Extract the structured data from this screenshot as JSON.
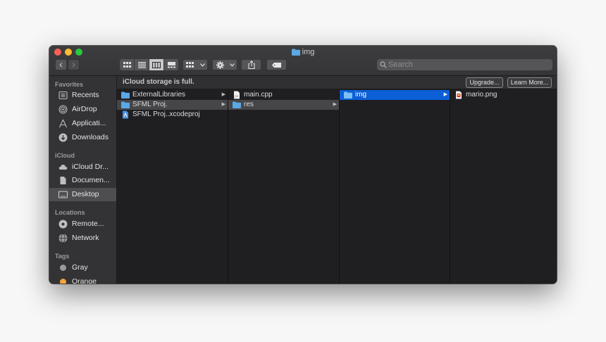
{
  "window": {
    "title": "img"
  },
  "toolbar": {
    "back_label": "‹",
    "forward_label": "›",
    "search_placeholder": "Search"
  },
  "sidebar": {
    "favorites_heading": "Favorites",
    "favorites": [
      {
        "label": "Recents",
        "icon": "clock-icon"
      },
      {
        "label": "AirDrop",
        "icon": "airdrop-icon"
      },
      {
        "label": "Applicati...",
        "icon": "applications-icon"
      },
      {
        "label": "Downloads",
        "icon": "download-icon"
      }
    ],
    "icloud_heading": "iCloud",
    "icloud": [
      {
        "label": "iCloud Dr...",
        "icon": "cloud-icon"
      },
      {
        "label": "Documen...",
        "icon": "document-icon"
      },
      {
        "label": "Desktop",
        "icon": "desktop-icon",
        "selected": true
      }
    ],
    "locations_heading": "Locations",
    "locations": [
      {
        "label": "Remote...",
        "icon": "disc-icon"
      },
      {
        "label": "Network",
        "icon": "network-icon"
      }
    ],
    "tags_heading": "Tags",
    "tags": [
      {
        "label": "Gray",
        "color": "#9a9a9c"
      },
      {
        "label": "Orange",
        "color": "#f5a43a"
      }
    ]
  },
  "banner": {
    "message": "iCloud storage is full.",
    "upgrade_label": "Upgrade...",
    "learn_more_label": "Learn More..."
  },
  "columns": [
    [
      {
        "label": "ExternalLibraries",
        "type": "folder",
        "has_children": true
      },
      {
        "label": "SFML Proj.",
        "type": "folder",
        "has_children": true,
        "state": "highlight"
      },
      {
        "label": "SFML Proj..xcodeproj",
        "type": "xcodeproj",
        "has_children": false
      }
    ],
    [
      {
        "label": "main.cpp",
        "type": "cpp-file",
        "has_children": false
      },
      {
        "label": "res",
        "type": "folder",
        "has_children": true,
        "state": "highlight"
      }
    ],
    [
      {
        "label": "img",
        "type": "folder",
        "has_children": true,
        "state": "active"
      }
    ],
    [
      {
        "label": "mario.png",
        "type": "image-file",
        "has_children": false
      }
    ]
  ],
  "colors": {
    "accent": "#0b5fd7",
    "folder": "#5aa8e6",
    "window_bg": "#2a2a2c"
  }
}
